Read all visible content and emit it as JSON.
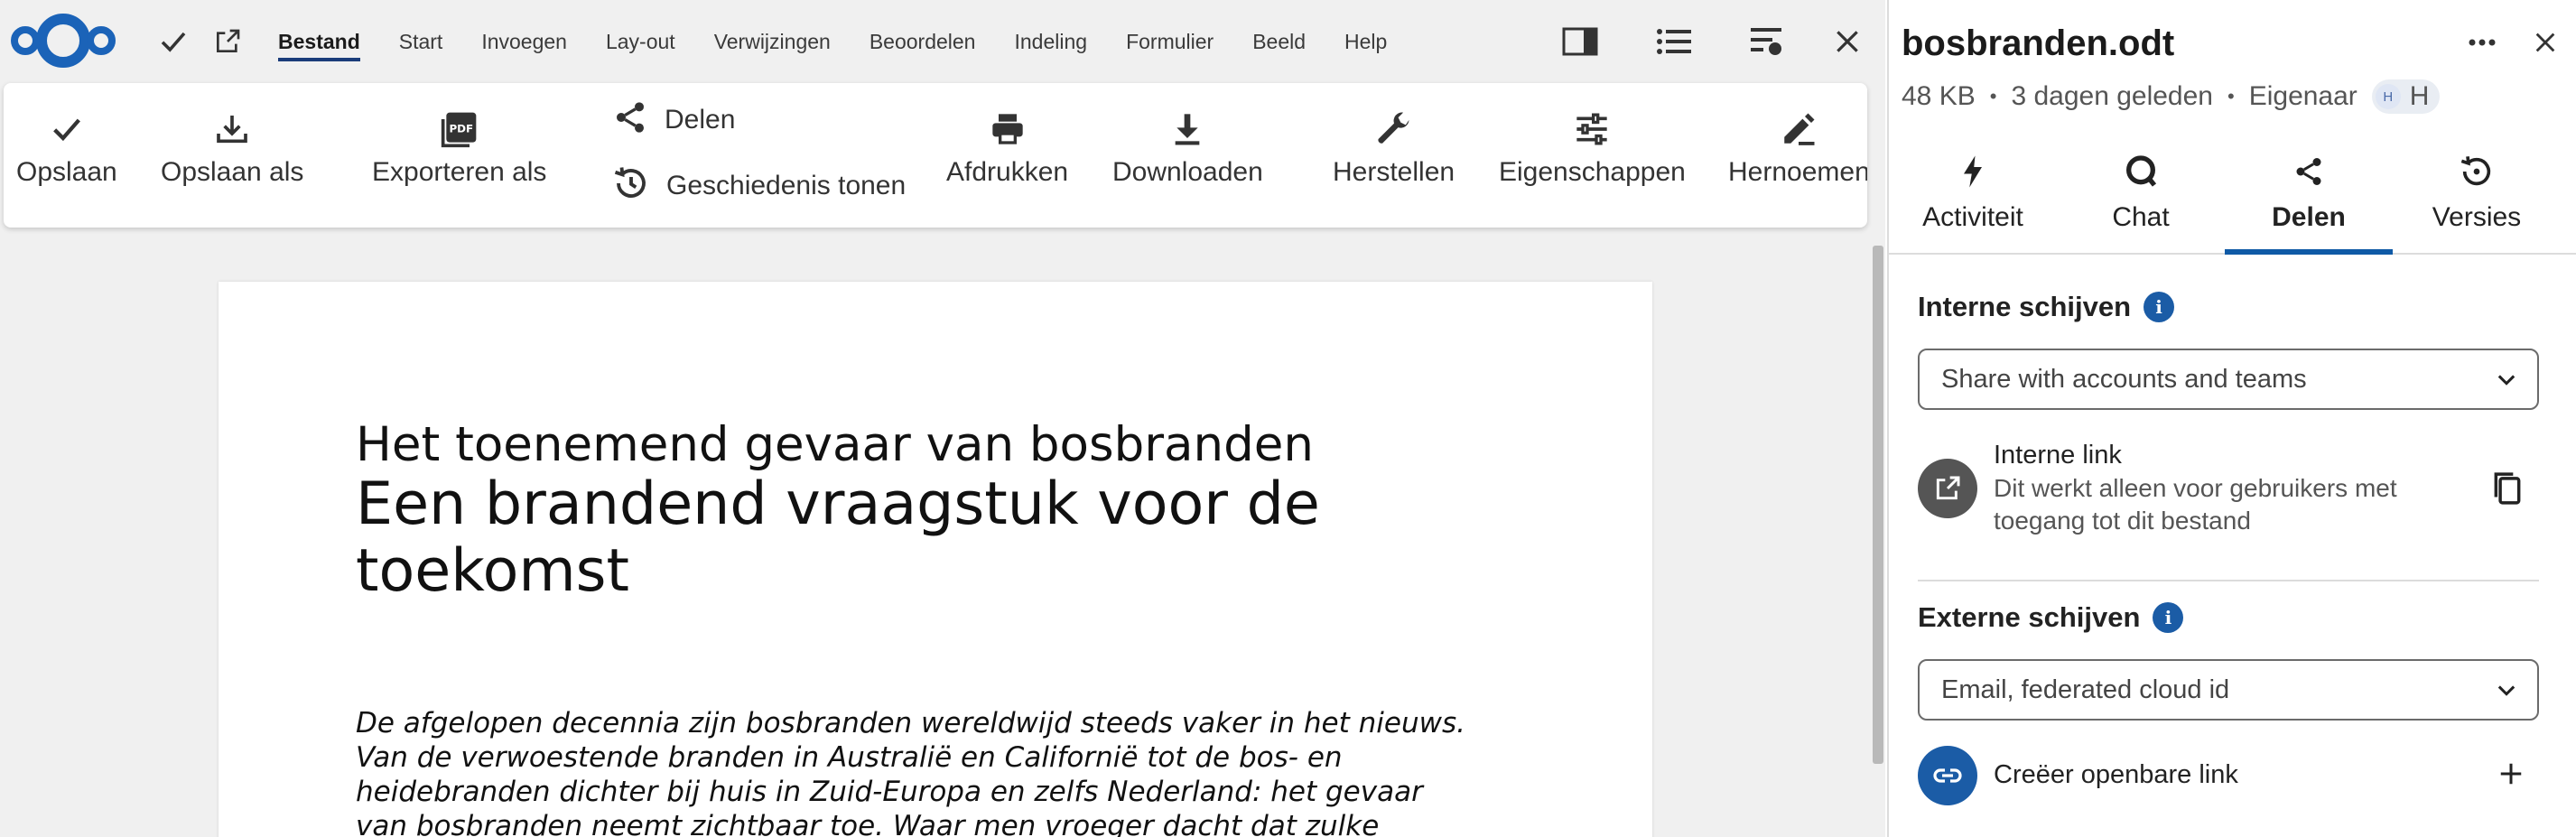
{
  "menubar": {
    "items": [
      "Bestand",
      "Start",
      "Invoegen",
      "Lay-out",
      "Verwijzingen",
      "Beoordelen",
      "Indeling",
      "Formulier",
      "Beeld",
      "Help"
    ],
    "active": "Bestand"
  },
  "toolbar": {
    "save": "Opslaan",
    "save_as": "Opslaan als",
    "export_as": "Exporteren als",
    "share": "Delen",
    "history": "Geschiedenis tonen",
    "print": "Afdrukken",
    "download": "Downloaden",
    "repair": "Herstellen",
    "properties": "Eigenschappen",
    "rename": "Hernoemen"
  },
  "document": {
    "title": "Het toenemend gevaar van bosbranden",
    "subtitle": "Een brandend vraagstuk voor de toekomst",
    "body": "De afgelopen decennia zijn bosbranden wereldwijd steeds vaker in het nieuws.\nVan de verwoestende branden in Australië en Californië tot de bos- en\nheidebranden dichter bij huis in Zuid-Europa en zelfs Nederland: het gevaar\nvan bosbranden neemt zichtbaar toe. Waar men vroeger dacht dat zulke"
  },
  "sidebar": {
    "file_name": "bosbranden.odt",
    "size": "48 KB",
    "modified": "3 dagen geleden",
    "owner_label": "Eigenaar",
    "owner_initial": "H",
    "owner_name": "H",
    "tabs": [
      {
        "label": "Activiteit",
        "icon": "lightning-icon"
      },
      {
        "label": "Chat",
        "icon": "chat-icon"
      },
      {
        "label": "Delen",
        "icon": "share-icon"
      },
      {
        "label": "Versies",
        "icon": "history-icon"
      }
    ],
    "active_tab": "Delen",
    "internal": {
      "title": "Interne schijven",
      "select_placeholder": "Share with accounts and teams",
      "link_title": "Interne link",
      "link_sub_1": "Dit werkt alleen voor gebruikers met",
      "link_sub_2": "toegang tot dit bestand"
    },
    "external": {
      "title": "Externe schijven",
      "select_placeholder": "Email, federated cloud id",
      "public_link": "Creëer openbare link"
    }
  },
  "colors": {
    "accent": "#0f5aa6",
    "logo": "#1b63b8"
  }
}
